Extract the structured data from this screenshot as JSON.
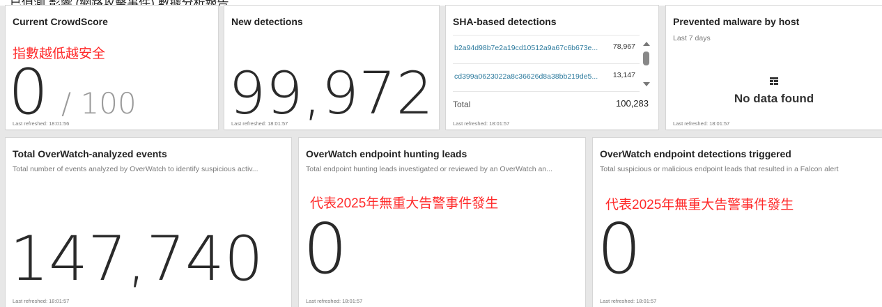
{
  "top_note": "已偵測 影響 (網路攻擊事件) 數據分析報告",
  "cards": {
    "crowdscore": {
      "title": "Current CrowdScore",
      "note": "指數越低越安全",
      "value": "0",
      "suffix": "/ 100",
      "refreshed": "Last refreshed: 18:01:56"
    },
    "new_detections": {
      "title": "New detections",
      "value": "99,972",
      "refreshed": "Last refreshed: 18:01:57"
    },
    "sha": {
      "title": "SHA-based detections",
      "rows": [
        {
          "hash": "b2a94d98b7e2a19cd10512a9a67c6b673e...",
          "count": "78,967"
        },
        {
          "hash": "cd399a0623022a8c36626d8a38bb219de5...",
          "count": "13,147"
        }
      ],
      "total_label": "Total",
      "total_value": "100,283",
      "refreshed": "Last refreshed: 18:01:57"
    },
    "prevented": {
      "title": "Prevented malware by host",
      "subtitle": "Last 7 days",
      "nodata": "No data found",
      "refreshed": "Last refreshed: 18:01:57"
    },
    "overwatch_events": {
      "title": "Total OverWatch-analyzed events",
      "subtitle": "Total number of events analyzed by OverWatch to identify suspicious activ...",
      "value": "147,740",
      "refreshed": "Last refreshed: 18:01:57"
    },
    "hunting_leads": {
      "title": "OverWatch endpoint hunting leads",
      "subtitle": "Total endpoint hunting leads investigated or reviewed by an OverWatch an...",
      "note": "代表2025年無重大告警事件發生",
      "value": "0",
      "refreshed": "Last refreshed: 18:01:57"
    },
    "detections_triggered": {
      "title": "OverWatch endpoint detections triggered",
      "subtitle": "Total suspicious or malicious endpoint leads that resulted in a Falcon alert",
      "note": "代表2025年無重大告警事件發生",
      "value": "0",
      "refreshed": "Last refreshed: 18:01:57"
    }
  },
  "colors": {
    "note_red": "#ff2a2a",
    "link_blue": "#2d7b9e",
    "background": "#e7e7e7"
  },
  "icons": {
    "scroll_up": "scroll-up-icon",
    "scroll_down": "scroll-down-icon",
    "nodata": "table-icon"
  }
}
